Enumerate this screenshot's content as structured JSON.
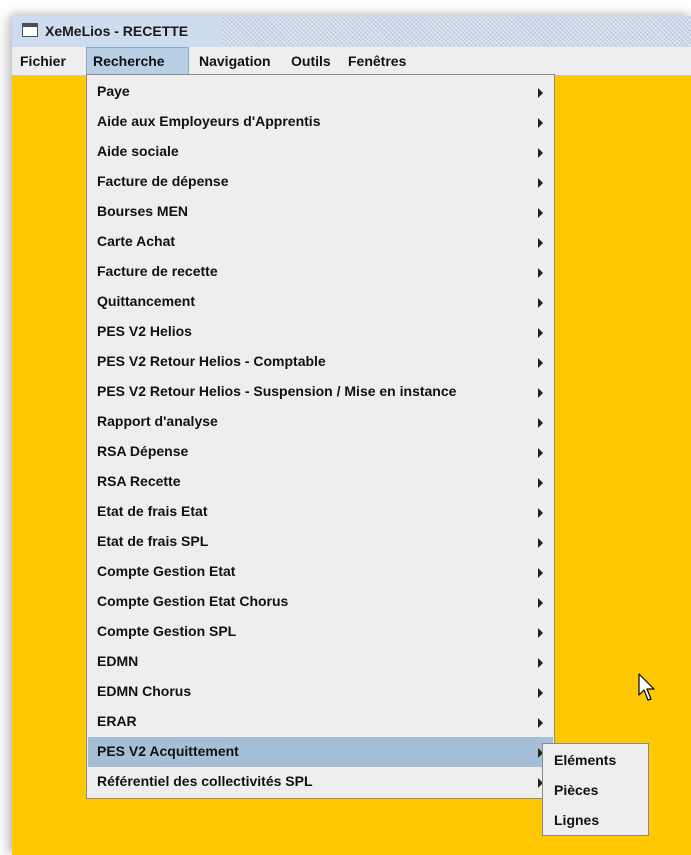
{
  "window": {
    "title": "XeMeLios - RECETTE",
    "icon": "window-icon"
  },
  "menubar": {
    "items": [
      {
        "label": "Fichier"
      },
      {
        "label": "Recherche",
        "active": true
      },
      {
        "label": "Navigation"
      },
      {
        "label": "Outils"
      },
      {
        "label": "Fenêtres"
      }
    ]
  },
  "recherche_menu": {
    "items": [
      {
        "label": "Paye"
      },
      {
        "label": "Aide aux Employeurs d'Apprentis"
      },
      {
        "label": "Aide sociale"
      },
      {
        "label": "Facture de dépense"
      },
      {
        "label": "Bourses MEN"
      },
      {
        "label": "Carte Achat"
      },
      {
        "label": "Facture de recette"
      },
      {
        "label": "Quittancement"
      },
      {
        "label": "PES V2 Helios"
      },
      {
        "label": "PES V2 Retour Helios - Comptable"
      },
      {
        "label": "PES V2 Retour Helios - Suspension / Mise en instance"
      },
      {
        "label": "Rapport d'analyse"
      },
      {
        "label": "RSA Dépense"
      },
      {
        "label": "RSA Recette"
      },
      {
        "label": "Etat de frais Etat"
      },
      {
        "label": "Etat de frais SPL"
      },
      {
        "label": "Compte Gestion Etat"
      },
      {
        "label": "Compte Gestion Etat Chorus"
      },
      {
        "label": "Compte Gestion SPL"
      },
      {
        "label": "EDMN"
      },
      {
        "label": "EDMN Chorus"
      },
      {
        "label": "ERAR"
      },
      {
        "label": "PES V2 Acquittement",
        "highlighted": true
      },
      {
        "label": "Référentiel des collectivités SPL"
      }
    ]
  },
  "pes_v2_acquittement_submenu": {
    "items": [
      {
        "label": "Eléments"
      },
      {
        "label": "Pièces"
      },
      {
        "label": "Lignes"
      }
    ]
  },
  "colors": {
    "desktop_background": "#ffc800",
    "menu_background": "#eeeeee",
    "menu_highlight": "#a7bed8",
    "menubar_active": "#b8cfe5"
  },
  "cursor": {
    "icon": "mouse-pointer-icon"
  }
}
